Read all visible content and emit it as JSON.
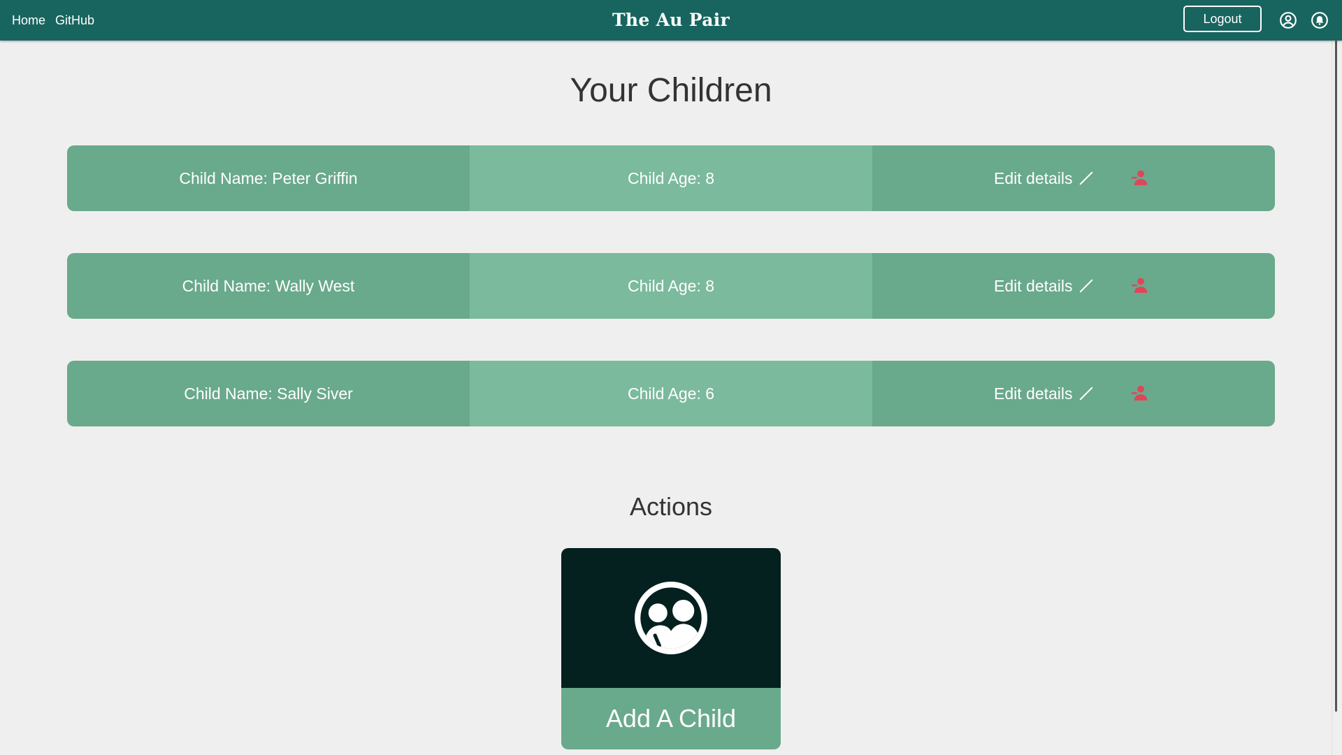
{
  "nav": {
    "links": [
      {
        "label": "Home"
      },
      {
        "label": "GitHub"
      }
    ],
    "brand": "The Au Pair",
    "logout_label": "Logout"
  },
  "page_title": "Your Children",
  "children": [
    {
      "name": "Child Name: Peter Griffin",
      "age": "Child Age: 8",
      "edit_label": "Edit details"
    },
    {
      "name": "Child Name: Wally West",
      "age": "Child Age: 8",
      "edit_label": "Edit details"
    },
    {
      "name": "Child Name: Sally Siver",
      "age": "Child Age: 6",
      "edit_label": "Edit details"
    }
  ],
  "actions": {
    "title": "Actions",
    "add_child_label": "Add A Child"
  },
  "icons": {
    "profile": "user-circle-icon",
    "notifications": "bell-icon",
    "edit": "pencil-icon",
    "remove": "remove-user-icon",
    "add_child": "group-icon"
  },
  "colors": {
    "navbar": "#18655f",
    "card_dark": "#69a98c",
    "card_light": "#7bba9d",
    "remove_icon": "#e0455a",
    "add_card_top": "#04201f",
    "background": "#efefef"
  }
}
